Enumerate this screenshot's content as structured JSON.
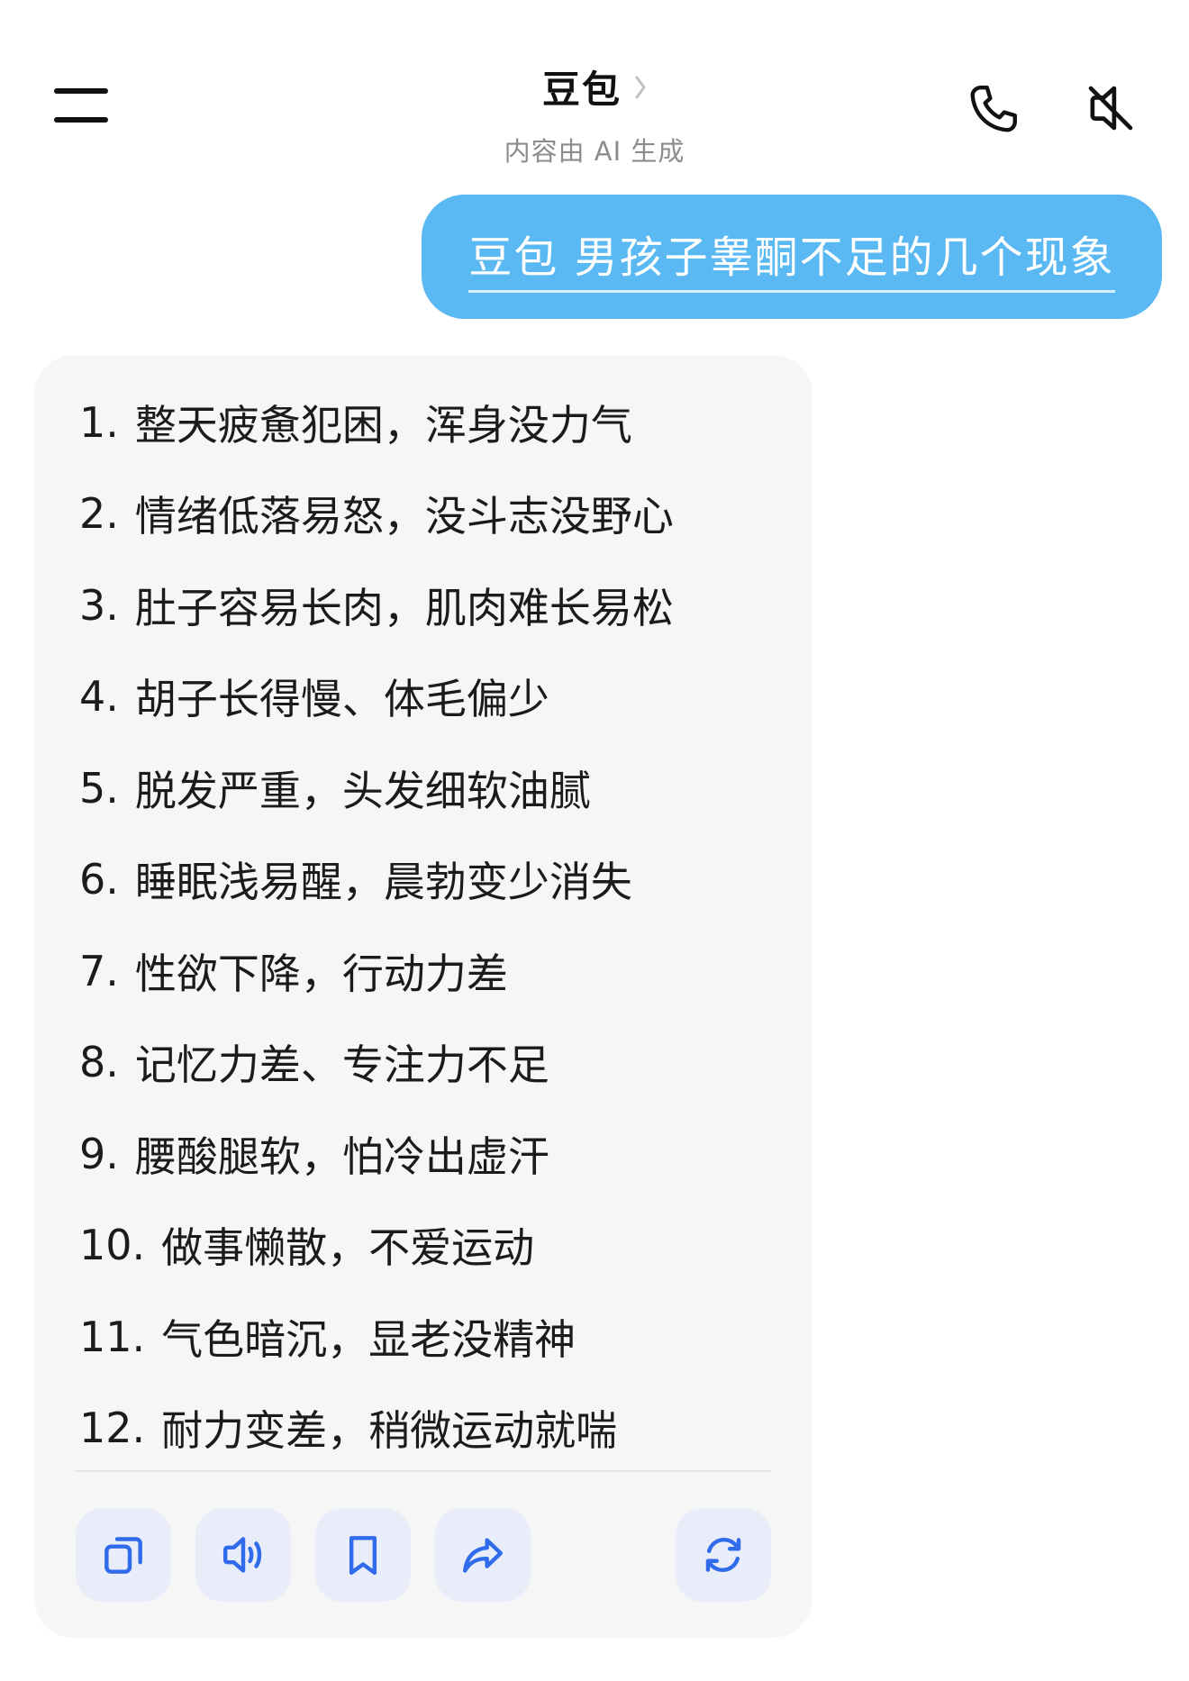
{
  "header": {
    "title": "豆包",
    "subtitle": "内容由 AI 生成",
    "icons": {
      "menu": "menu-icon",
      "phone": "phone-icon",
      "mute": "speaker-muted-icon",
      "chevron": "chevron-right-icon"
    }
  },
  "user_message": {
    "text": "豆包 男孩子睾酮不足的几个现象"
  },
  "ai_response": {
    "items": [
      {
        "num": "1.",
        "text": "整天疲惫犯困，浑身没力气"
      },
      {
        "num": "2.",
        "text": "情绪低落易怒，没斗志没野心"
      },
      {
        "num": "3.",
        "text": "肚子容易长肉，肌肉难长易松"
      },
      {
        "num": "4.",
        "text": "胡子长得慢、体毛偏少"
      },
      {
        "num": "5.",
        "text": "脱发严重，头发细软油腻"
      },
      {
        "num": "6.",
        "text": "睡眠浅易醒，晨勃变少消失"
      },
      {
        "num": "7.",
        "text": "性欲下降，行动力差"
      },
      {
        "num": "8.",
        "text": "记忆力差、专注力不足"
      },
      {
        "num": "9.",
        "text": "腰酸腿软，怕冷出虚汗"
      },
      {
        "num": "10.",
        "text": "做事懒散，不爱运动"
      },
      {
        "num": "11.",
        "text": "气色暗沉，显老没精神"
      },
      {
        "num": "12.",
        "text": "耐力变差，稍微运动就喘"
      }
    ],
    "actions": [
      "copy-icon",
      "speaker-icon",
      "bookmark-icon",
      "share-icon",
      "regenerate-icon"
    ]
  },
  "colors": {
    "user_bubble": "#5ab8f2",
    "card_bg": "#f6f6f7",
    "action_bg": "#e9edf9",
    "action_icon": "#2f6bea"
  }
}
